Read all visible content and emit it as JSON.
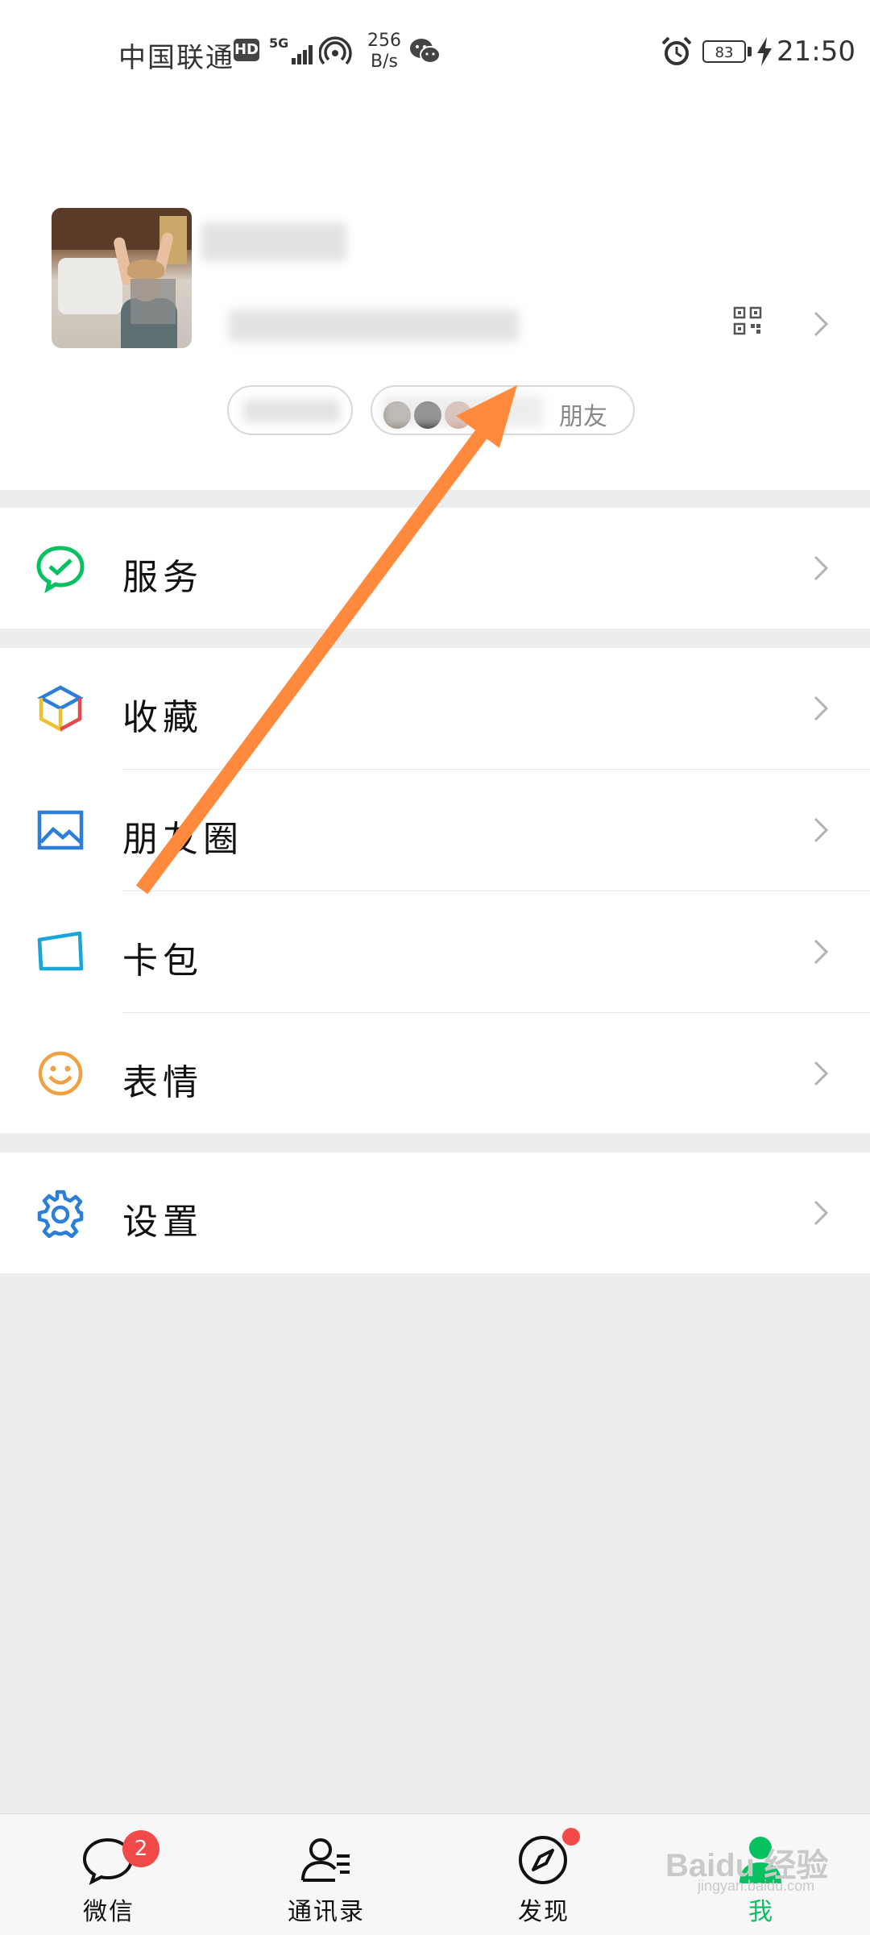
{
  "status_bar": {
    "carrier": "中国联通",
    "hd_badge": "HD",
    "network": "5G",
    "speed_value": "256",
    "speed_unit": "B/s",
    "battery": "83",
    "time": "21:50"
  },
  "profile": {
    "friends_label": "朋友"
  },
  "menu": {
    "service": "服务",
    "favorites": "收藏",
    "moments": "朋友圈",
    "cards": "卡包",
    "stickers": "表情",
    "settings": "设置"
  },
  "tabs": [
    {
      "label": "微信",
      "badge": "2"
    },
    {
      "label": "通讯录"
    },
    {
      "label": "发现"
    },
    {
      "label": "我"
    }
  ],
  "watermark": {
    "brand": "Baidu 经验",
    "url": "jingyan.baidu.com"
  },
  "colors": {
    "wechat_green": "#07c160",
    "annotation_arrow": "#ff8a3d",
    "badge_red": "#f24949",
    "icon_blue": "#2b7fd8",
    "icon_orange": "#f0a040"
  }
}
